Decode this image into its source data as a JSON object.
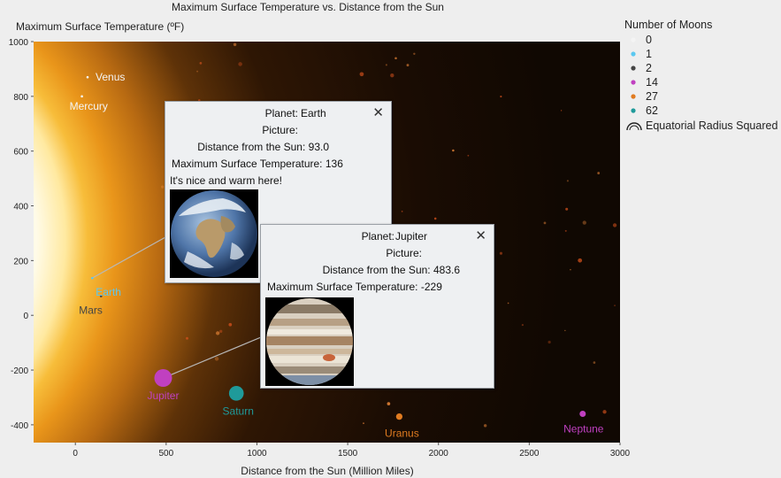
{
  "chart_data": {
    "type": "scatter",
    "title": "Maximum Surface Temperature vs. Distance from the Sun",
    "xlabel": "Distance from the Sun (Million Miles)",
    "ylabel": "Maximum Surface Temperature (ºF)",
    "xlim": [
      -230,
      3000
    ],
    "ylim": [
      -465,
      1000
    ],
    "xticks": [
      0,
      500,
      1000,
      1500,
      2000,
      2500,
      3000
    ],
    "yticks": [
      -400,
      -200,
      0,
      200,
      400,
      600,
      800,
      1000
    ],
    "legend_title": "Number of Moons",
    "legend_size_label": "Equatorial Radius Squared",
    "legend_placement": "top-right",
    "moon_groups": [
      {
        "label": "0",
        "color": "#f4f4f4"
      },
      {
        "label": "1",
        "color": "#5bc8f0"
      },
      {
        "label": "2",
        "color": "#444444"
      },
      {
        "label": "14",
        "color": "#c040c0"
      },
      {
        "label": "27",
        "color": "#e07b20"
      },
      {
        "label": "62",
        "color": "#1f9a9a"
      }
    ],
    "points": [
      {
        "planet": "Mercury",
        "x": 36,
        "y": 800,
        "moons": "0",
        "radius": 1516
      },
      {
        "planet": "Venus",
        "x": 67.2,
        "y": 870,
        "moons": "0",
        "radius": 3760
      },
      {
        "planet": "Earth",
        "x": 93.0,
        "y": 136,
        "moons": "1",
        "radius": 3959
      },
      {
        "planet": "Mars",
        "x": 141.6,
        "y": 70,
        "moons": "2",
        "radius": 2106
      },
      {
        "planet": "Jupiter",
        "x": 483.6,
        "y": -229,
        "moons": "14",
        "radius": 43441
      },
      {
        "planet": "Saturn",
        "x": 886.7,
        "y": -285,
        "moons": "62",
        "radius": 36184
      },
      {
        "planet": "Uranus",
        "x": 1784,
        "y": -370,
        "moons": "27",
        "radius": 15759
      },
      {
        "planet": "Neptune",
        "x": 2794.4,
        "y": -360,
        "moons": "14",
        "radius": 15299
      }
    ]
  },
  "tooltips": [
    {
      "planet_label": "Planet:",
      "planet": "Earth",
      "picture_label": "Picture:",
      "distance_label": "Distance from the Sun:",
      "distance": "93.0",
      "temp_label": "Maximum Surface Temperature:",
      "temp": "136",
      "note": "It's nice and warm here!",
      "close": "✕"
    },
    {
      "planet_label": "Planet:",
      "planet": "Jupiter",
      "picture_label": "Picture:",
      "distance_label": "Distance from the Sun:",
      "distance": "483.6",
      "temp_label": "Maximum Surface Temperature:",
      "temp": "-229",
      "close": "✕"
    }
  ]
}
